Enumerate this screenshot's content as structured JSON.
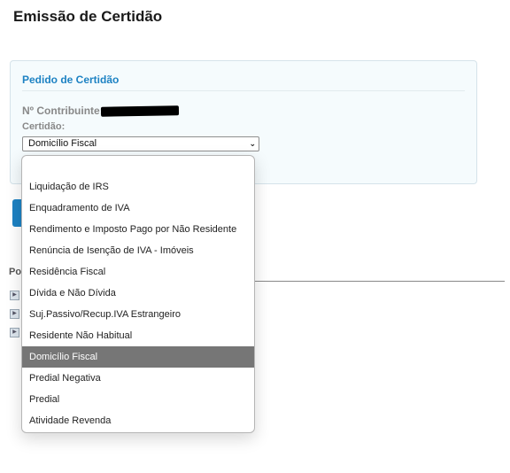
{
  "page": {
    "title": "Emissão de Certidão"
  },
  "panel": {
    "title": "Pedido de Certidão",
    "contribuinte_label": "Nº Contribuinte:",
    "certidao_label": "Certidão:",
    "selected_value": "Domicílio Fiscal"
  },
  "section": {
    "label_partial": "Po"
  },
  "dropdown": {
    "options": [
      "",
      "Liquidação de IRS",
      "Enquadramento de IVA",
      "Rendimento e Imposto Pago por Não Residente",
      "Renúncia de Isenção de IVA - Imóveis",
      "Residência Fiscal",
      "Dívida e Não Dívida",
      "Suj.Passivo/Recup.IVA Estrangeiro",
      "Residente Não Habitual",
      "Domicílio Fiscal",
      "Predial Negativa",
      "Predial",
      "Atividade Revenda"
    ],
    "selected_index": 9
  },
  "colors": {
    "accent": "#1d82c3",
    "selected_option_bg": "#767676"
  },
  "icons": {
    "link_bullet": "arrow-right-icon",
    "select_chevron": "chevron-down-icon"
  }
}
